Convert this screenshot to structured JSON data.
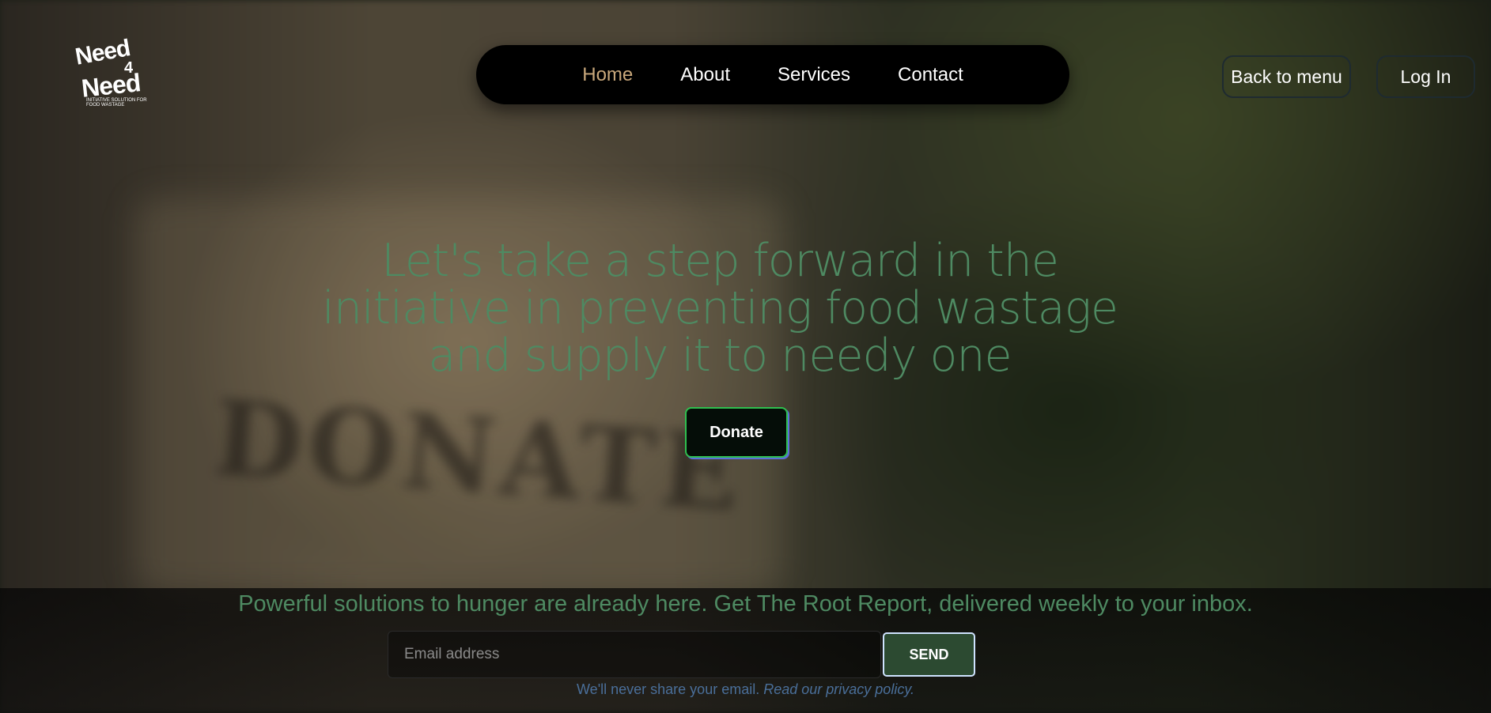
{
  "logo": {
    "line1": "Need",
    "line2": "4",
    "line3": "Need",
    "tagline": "INITIATIVE SOLUTION FOR FOOD WASTAGE"
  },
  "nav": {
    "items": [
      {
        "label": "Home",
        "active": true
      },
      {
        "label": "About"
      },
      {
        "label": "Services"
      },
      {
        "label": "Contact"
      }
    ]
  },
  "header": {
    "back_label": "Back to menu",
    "login_label": "Log In"
  },
  "hero": {
    "headline": "Let's take a step forward in the initiative in preventing food wastage and supply it to needy one",
    "donate_label": "Donate"
  },
  "newsletter": {
    "title": "Powerful solutions to hunger are already here. Get The Root Report, delivered weekly to your inbox.",
    "email_placeholder": "Email address",
    "send_label": "SEND",
    "privacy_text": "We'll never share your email.",
    "privacy_link": "Read our privacy policy."
  },
  "background": {
    "word": "DONATE"
  },
  "colors": {
    "accent_green": "#4e8a62",
    "active_nav": "#c9a87b",
    "send_bg": "#2c4a31",
    "privacy_blue": "#4a6f9a"
  }
}
